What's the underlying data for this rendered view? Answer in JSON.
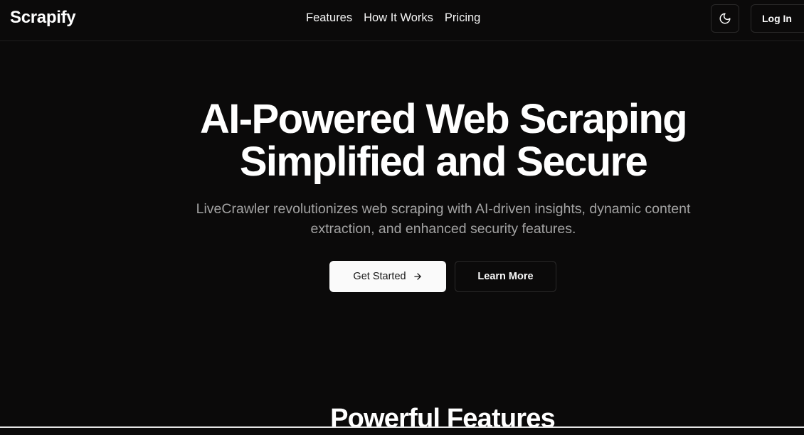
{
  "nav": {
    "brand": "Scrapify",
    "links": [
      "Features",
      "How It Works",
      "Pricing"
    ],
    "theme_toggle_icon": "moon-icon",
    "login_label": "Log In"
  },
  "hero": {
    "title_line1": "AI-Powered Web Scraping",
    "title_line2": "Simplified and Secure",
    "subtitle": "LiveCrawler revolutionizes web scraping with AI-driven insights, dynamic content extraction, and enhanced security features.",
    "primary_cta": "Get Started",
    "primary_cta_icon": "arrow-right-icon",
    "secondary_cta": "Learn More"
  },
  "features_section": {
    "title": "Powerful Features"
  },
  "colors": {
    "background": "#0b0a0a",
    "foreground": "#fafafa",
    "muted_text": "#a3a3a3",
    "border": "#2a2929",
    "primary_button_bg": "#fafafa",
    "primary_button_text": "#171717"
  }
}
